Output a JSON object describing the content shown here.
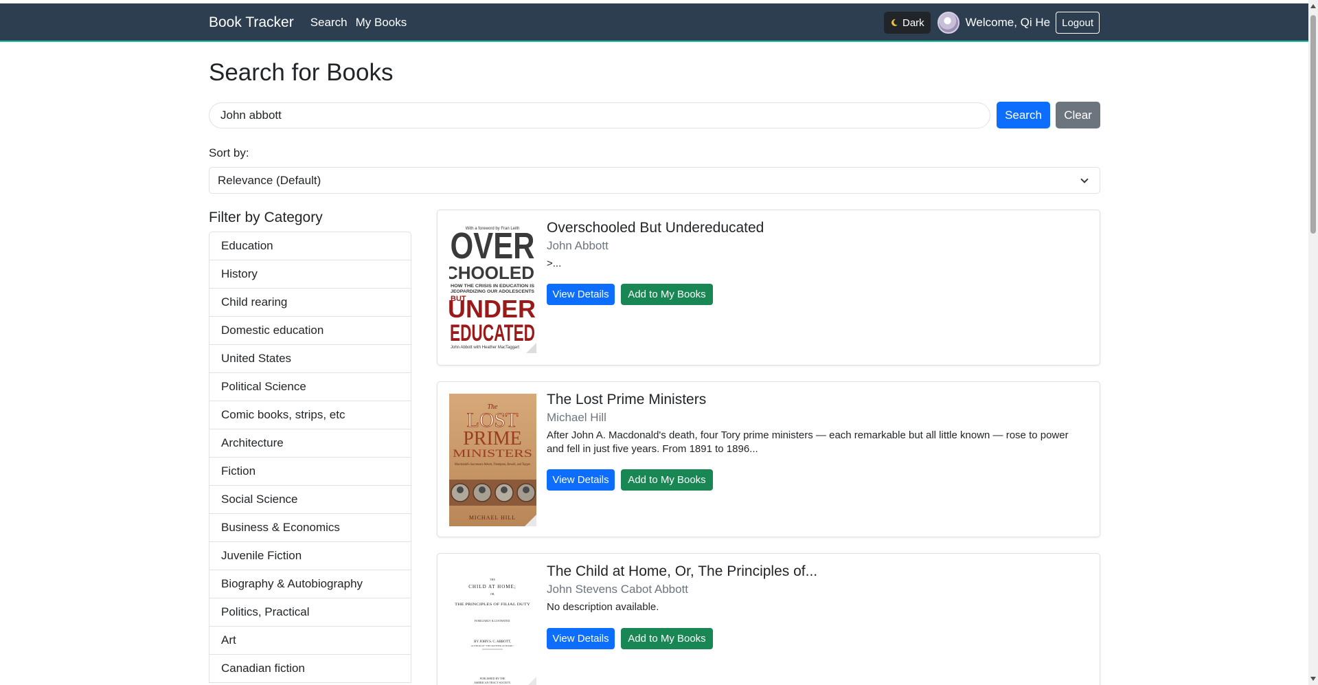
{
  "navbar": {
    "brand": "Book Tracker",
    "links": [
      "Search",
      "My Books"
    ],
    "theme_toggle": {
      "icon": "moon-icon",
      "label": "Dark"
    },
    "welcome": "Welcome, Qi He",
    "logout": "Logout"
  },
  "page": {
    "title": "Search for Books",
    "search": {
      "value": "John abbott",
      "button": "Search",
      "clear": "Clear"
    },
    "sort": {
      "label": "Sort by:",
      "selected": "Relevance (Default)"
    }
  },
  "filter": {
    "title": "Filter by Category",
    "categories": [
      "Education",
      "History",
      "Child rearing",
      "Domestic education",
      "United States",
      "Political Science",
      "Comic books, strips, etc",
      "Architecture",
      "Fiction",
      "Social Science",
      "Business & Economics",
      "Juvenile Fiction",
      "Biography & Autobiography",
      "Politics, Practical",
      "Art",
      "Canadian fiction"
    ]
  },
  "results": [
    {
      "title": "Overschooled But Undereducated",
      "author": "John Abbott",
      "description": ">...",
      "cover": {
        "foreword": "With a foreword by Fran Leith",
        "line1": "OVER",
        "line2": "SCHOOLED",
        "subtitle1": "HOW THE CRISIS IN EDUCATION IS",
        "subtitle2": "JEOPARDIZING OUR ADOLESCENTS",
        "but": "BUT",
        "line3": "UNDER",
        "line4": "EDUCATED",
        "authors": "John Abbott with Heather MacTaggart"
      }
    },
    {
      "title": "The Lost Prime Ministers",
      "author": "Michael Hill",
      "description": "After John A. Macdonald's death, four Tory prime ministers — each remarkable but all little known — rose to power and fell in just five years. From 1891 to 1896...",
      "cover": {
        "the": "The",
        "line1": "LOST",
        "line2": "PRIME",
        "line3": "MINISTERS",
        "subtitle": "Macdonald's Successors Abbott, Thompson, Bowell, and Tupper",
        "author": "MICHAEL HILL"
      }
    },
    {
      "title": "The Child at Home, Or, The Principles of...",
      "author": "John Stevens Cabot Abbott",
      "description": "No description available.",
      "cover": {
        "top": "THE",
        "line1": "CHILD AT HOME;",
        "or": "OR,",
        "line2": "THE PRINCIPLES OF FILIAL DUTY",
        "line3": "FAMILIARLY ILLUSTRATED.",
        "line4": "BY JOHN S. C. ABBOTT,",
        "line5": "AUTHOR OF \"THE MOTHER AT HOME.\"",
        "line6": "PUBLISHED BY THE",
        "line7": "AMERICAN TRACT SOCIETY,"
      }
    }
  ],
  "card_buttons": {
    "view": "View Details",
    "add": "Add to My Books"
  },
  "colors": {
    "navbar": "#2c3e50",
    "navbar_accent": "#1abc9c",
    "primary": "#0d6efd",
    "success": "#198754",
    "secondary": "#6c757d"
  }
}
